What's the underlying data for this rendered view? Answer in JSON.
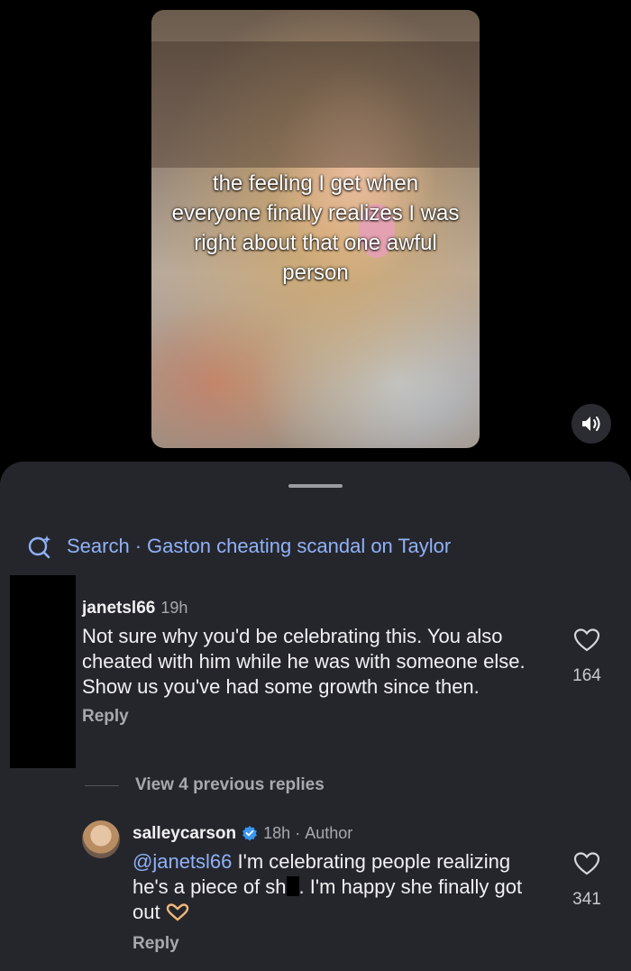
{
  "video": {
    "overlay_text": "the feeling I get when everyone finally realizes I was right about that one awful person"
  },
  "icons": {
    "mute": "speaker-icon",
    "search": "search-sparkle-icon",
    "like": "heart-icon",
    "verified": "verified-badge-icon",
    "emoji": "heart-hands-emoji"
  },
  "colors": {
    "sheet_bg": "#25262c",
    "link_blue": "#8fb2f8",
    "verified_blue": "#3897f0"
  },
  "search": {
    "prefix": "Search",
    "separator": "·",
    "query": "Gaston cheating scandal on Taylor"
  },
  "comments": [
    {
      "username": "janetsl66",
      "time": "19h",
      "text": "Not sure why you'd be celebrating this. You also cheated with him while he was with someone else. Show us you've had some growth since then.",
      "reply_label": "Reply",
      "likes": "164"
    },
    {
      "username": "salleycarson",
      "time": "18h",
      "separator": "·",
      "badge": "Author",
      "mention": "@janetsl66",
      "text": "I'm celebrating people realizing he's a piece of sh",
      "text_after": ". I'm happy she finally got out",
      "reply_label": "Reply",
      "likes": "341"
    }
  ],
  "view_replies_label": "View 4 previous replies"
}
